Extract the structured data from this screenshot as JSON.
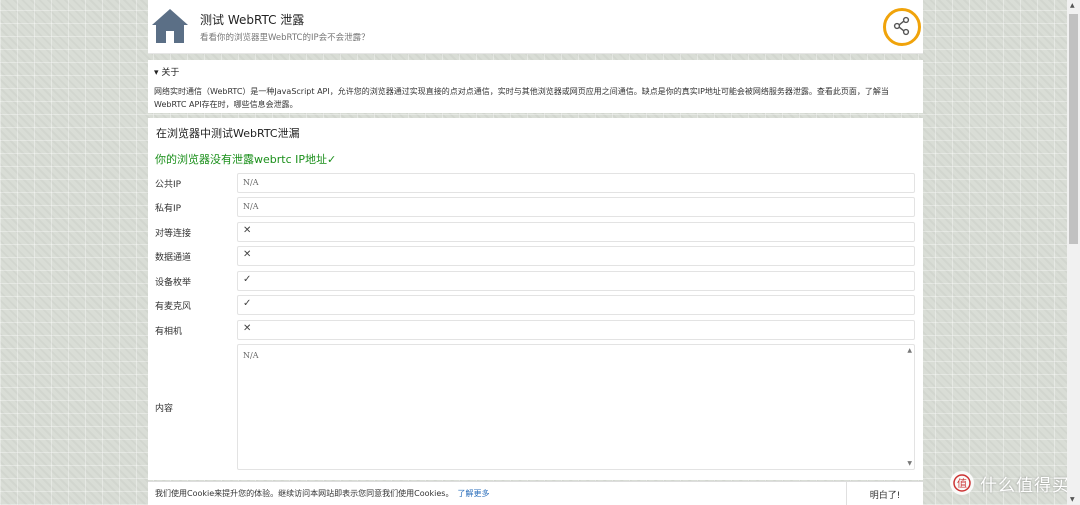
{
  "header": {
    "title": "测试 WebRTC 泄露",
    "subtitle": "看看你的浏览器里WebRTC的IP会不会泄露？"
  },
  "about": {
    "summary": "▾ 关于",
    "text": "网络实时通信（WebRTC）是一种JavaScript API，允许您的浏览器通过实现直接的点对点通信，实时与其他浏览器或网页应用之间通信。缺点是你的真实IP地址可能会被网络服务器泄露。查看此页面，了解当WebRTC API存在时，哪些信息会泄露。"
  },
  "main": {
    "title": "在浏览器中测试WebRTC泄漏",
    "status": "你的浏览器没有泄露webrtc IP地址✓",
    "rows": [
      {
        "label": "公共IP",
        "value": "N/A"
      },
      {
        "label": "私有IP",
        "value": "N/A"
      },
      {
        "label": "对等连接",
        "value": "✕"
      },
      {
        "label": "数据通道",
        "value": "✕"
      },
      {
        "label": "设备枚举",
        "value": "✓"
      },
      {
        "label": "有麦克风",
        "value": "✓"
      },
      {
        "label": "有相机",
        "value": "✕"
      }
    ],
    "content_label": "内容",
    "content_value": "N/A"
  },
  "cookie": {
    "text": "我们使用Cookie来提升您的体验。继续访问本网站即表示您同意我们使用Cookies。",
    "link": "了解更多",
    "button": "明白了!"
  },
  "watermark": {
    "logo": "值",
    "text": "什么值得买"
  },
  "colors": {
    "accent": "#f0a30a",
    "status_green": "#1a8f1a",
    "link": "#2a6ebb",
    "home_icon": "#5b6f86"
  },
  "icons": {
    "home": "home-icon",
    "share": "share-icon"
  }
}
